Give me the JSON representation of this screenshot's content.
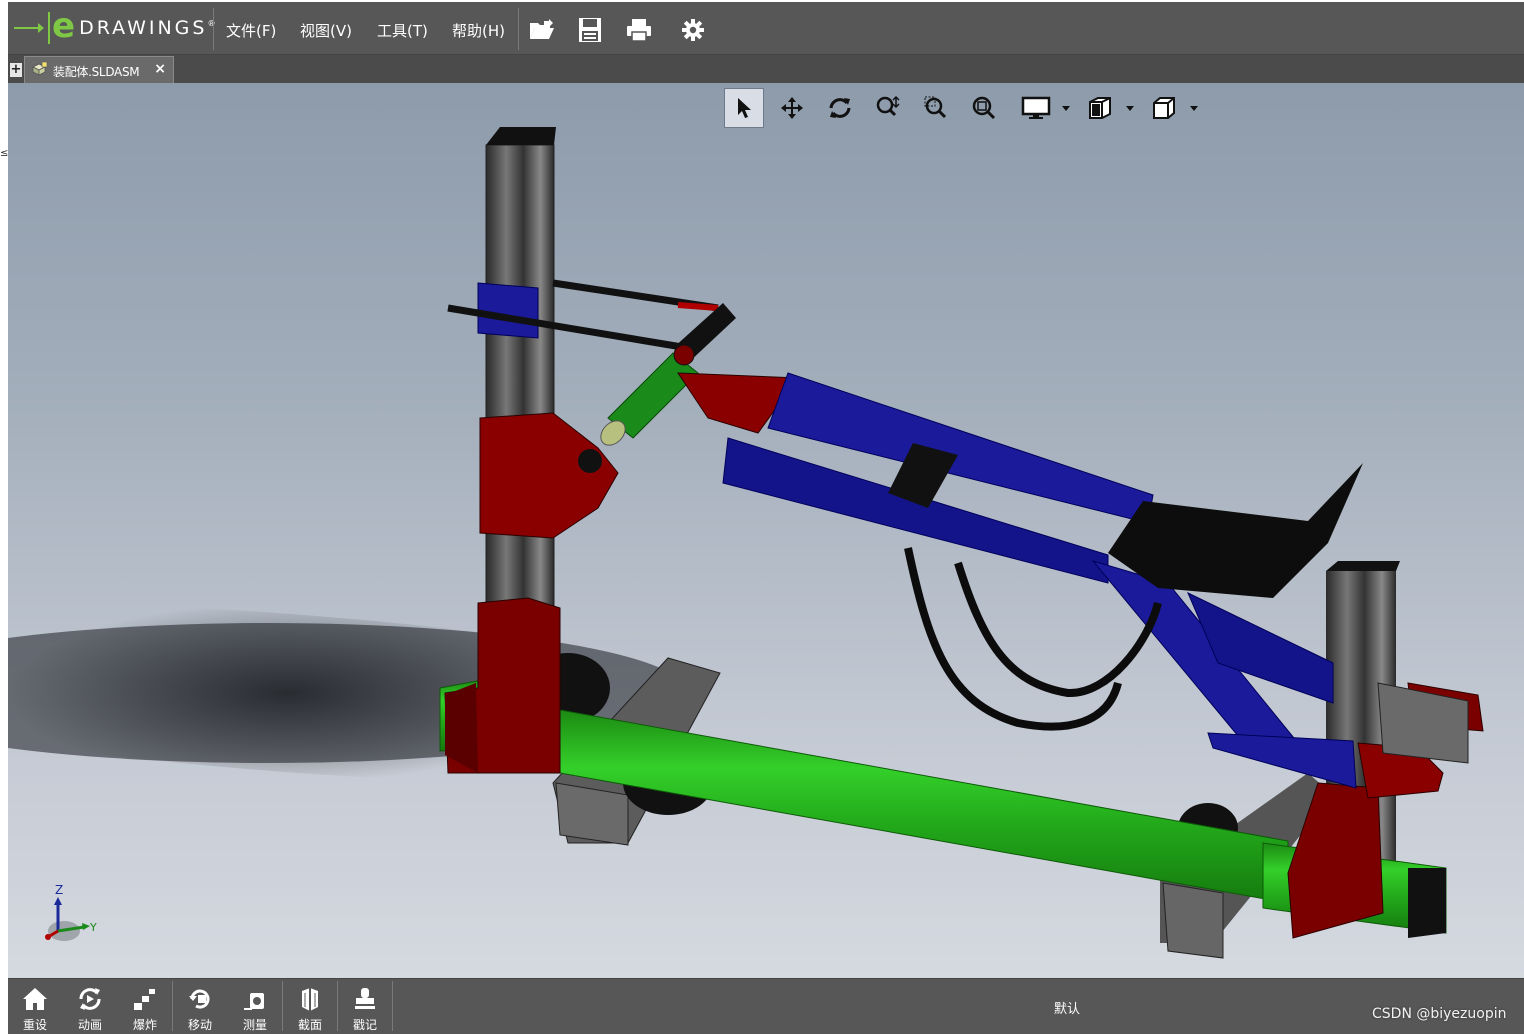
{
  "app": {
    "logo_text": "DRAWINGS",
    "logo_letter": "e"
  },
  "menu": [
    "文件(F)",
    "视图(V)",
    "工具(T)",
    "帮助(H)"
  ],
  "toolbar_icons": [
    "open-folder-icon",
    "save-icon",
    "print-icon",
    "gear-icon"
  ],
  "tab": {
    "label": "装配体.SLDASM",
    "close": "×",
    "add": "+"
  },
  "view_tools": [
    "select-arrow-icon",
    "pan-icon",
    "rotate-icon",
    "zoom-icon",
    "zoom-window-icon",
    "zoom-fit-icon",
    "display-style-icon",
    "display-mode-icon",
    "view-orientation-icon"
  ],
  "triad": {
    "z": "Z",
    "y": "Y"
  },
  "bottom_tools": [
    {
      "label": "重设",
      "icon": "home-icon"
    },
    {
      "label": "动画",
      "icon": "animate-icon"
    },
    {
      "label": "爆炸",
      "icon": "explode-icon"
    },
    {
      "label": "移动",
      "icon": "move-icon"
    },
    {
      "label": "测量",
      "icon": "measure-icon"
    },
    {
      "label": "截面",
      "icon": "section-icon"
    },
    {
      "label": "戳记",
      "icon": "stamp-icon"
    }
  ],
  "configuration": "默认",
  "watermark": "CSDN @biyezuopin"
}
